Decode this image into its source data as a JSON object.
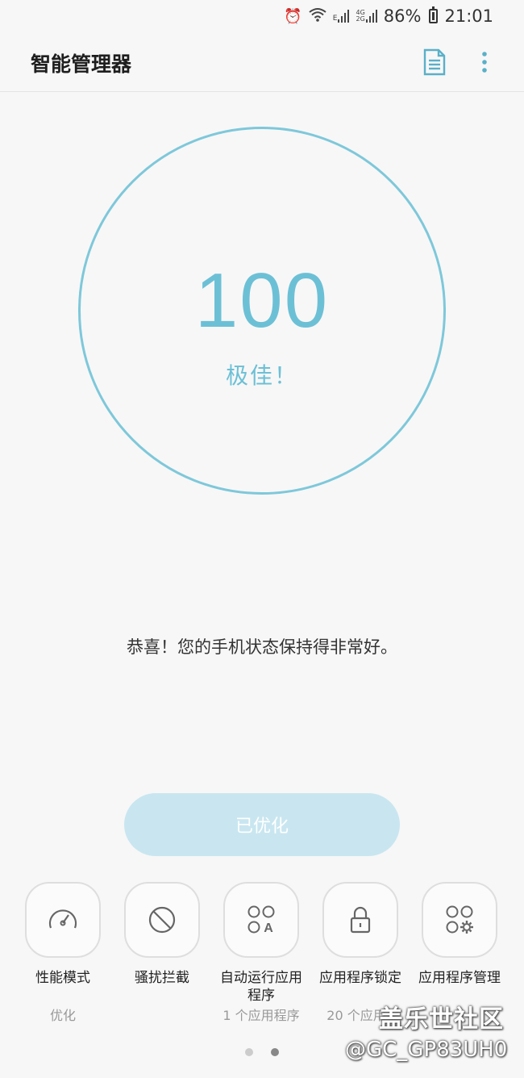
{
  "status_bar": {
    "network_labels": [
      "E",
      "4G",
      "2G"
    ],
    "battery": "86%",
    "time": "21:01"
  },
  "app": {
    "title": "智能管理器"
  },
  "score": {
    "value": "100",
    "rating": "极佳！"
  },
  "message": "恭喜！您的手机状态保持得非常好。",
  "optimize_button": "已优化",
  "features": [
    {
      "label": "性能模式",
      "status": "优化",
      "icon": "speedometer-icon"
    },
    {
      "label": "骚扰拦截",
      "status": "",
      "icon": "block-icon"
    },
    {
      "label": "自动运行应用\n程序",
      "status": "1 个应用程序",
      "icon": "auto-run-apps-icon"
    },
    {
      "label": "应用程序锁定",
      "status": "20 个应用程",
      "icon": "lock-icon"
    },
    {
      "label": "应用程序管理",
      "status": "",
      "icon": "app-settings-icon"
    }
  ],
  "pager": {
    "count": 2,
    "active": 1
  },
  "watermark": {
    "brand": "盖乐世社区",
    "user": "@GC_GP83UH0"
  },
  "colors": {
    "accent": "#6cc0d6",
    "ring": "#7ec8da",
    "button_bg": "#c9e6f0",
    "background": "#f7f7f7"
  }
}
